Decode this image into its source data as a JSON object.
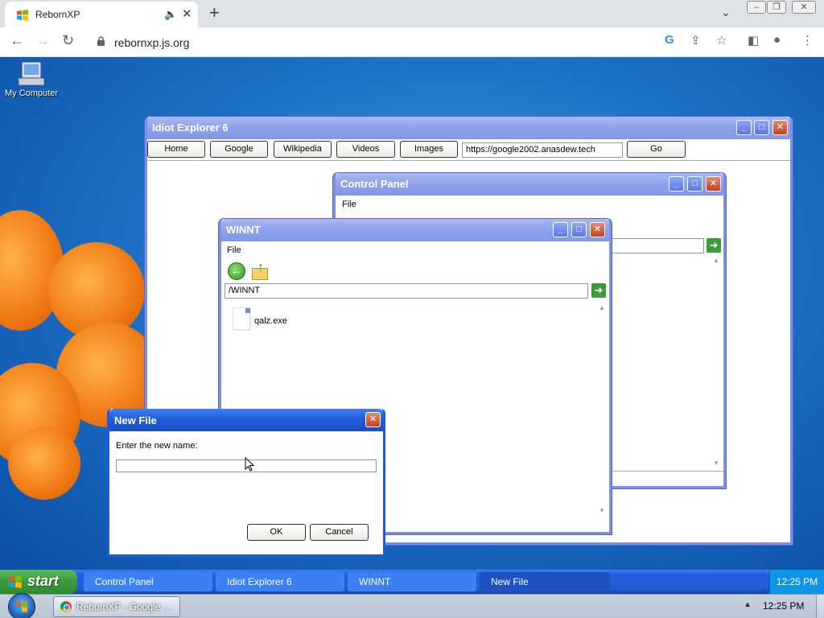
{
  "browser": {
    "tab_title": "RebornXP",
    "url": "rebornxp.js.org"
  },
  "desktop": {
    "icons": [
      {
        "label": "My Computer"
      }
    ]
  },
  "ie_window": {
    "title": "Idiot Explorer 6",
    "buttons": [
      "Home",
      "Google",
      "Wikipedia",
      "Videos",
      "Images"
    ],
    "address": "https://google2002.anasdew.tech",
    "go_label": "Go"
  },
  "control_panel": {
    "title": "Control Panel",
    "menu": "File"
  },
  "winnt": {
    "title": "WINNT",
    "menu": "File",
    "path": "/WINNT",
    "files": [
      {
        "name": "qalz.exe"
      }
    ]
  },
  "new_file_dialog": {
    "title": "New File",
    "prompt": "Enter the new name:",
    "input_value": "",
    "ok_label": "OK",
    "cancel_label": "Cancel"
  },
  "xp_taskbar": {
    "start_label": "start",
    "tasks": [
      "Control Panel",
      "Idiot Explorer 6",
      "WINNT",
      "New File"
    ],
    "active_task": "New File",
    "clock": "12:25 PM"
  },
  "host_taskbar": {
    "task_label": "RebornXP - Google ...",
    "clock": "12:25 PM"
  },
  "colors": {
    "xp_title_active": "#8ea2ea",
    "dialog_title": "#1f5ad8",
    "taskbar_blue": "#245edb",
    "start_green": "#3c9a3c",
    "close_red": "#c8401e"
  }
}
